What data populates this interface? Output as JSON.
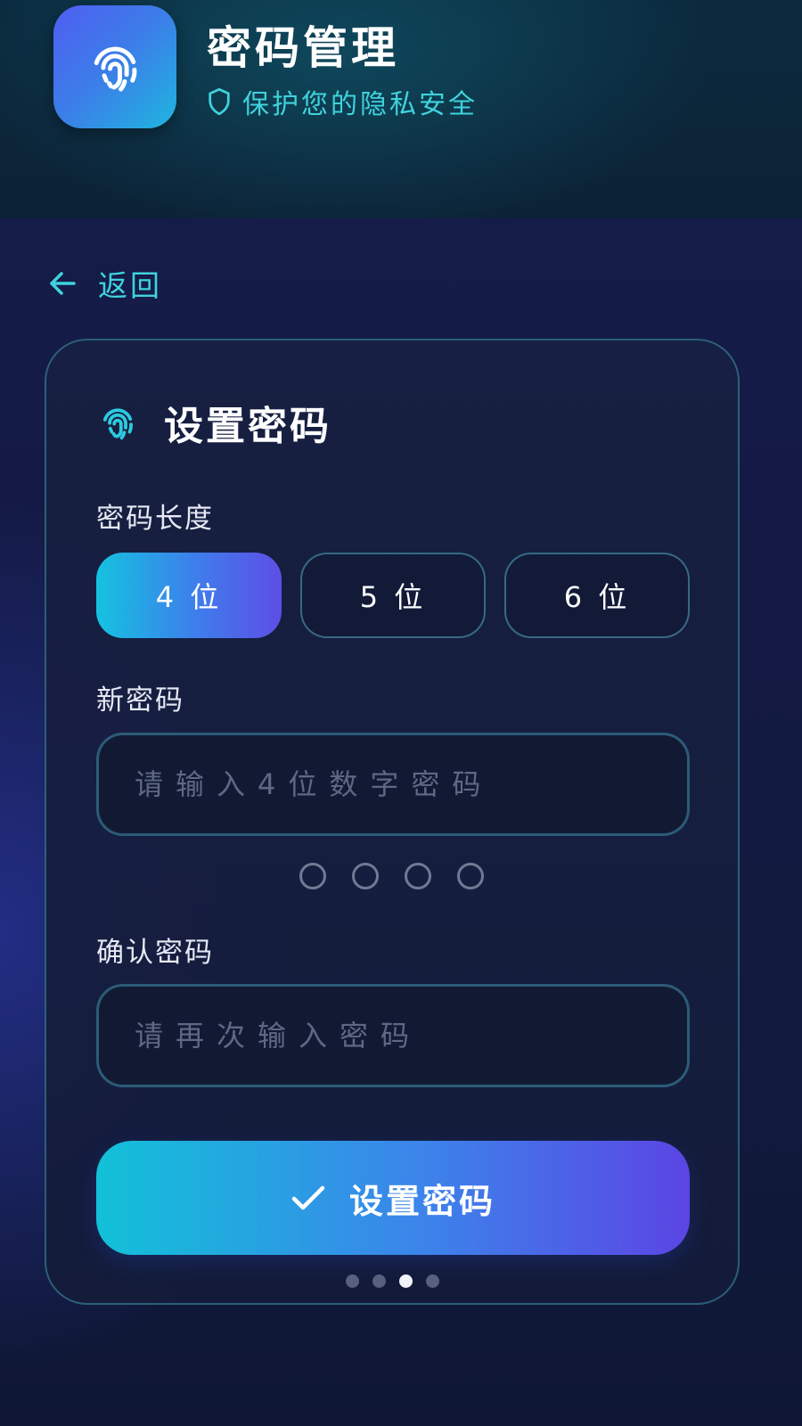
{
  "app": {
    "title": "密码管理",
    "subtitle": "保护您的隐私安全",
    "icon": "fingerprint-icon"
  },
  "nav": {
    "back_label": "返回",
    "back_icon": "arrow-left-icon"
  },
  "card": {
    "title": "设置密码",
    "icon": "fingerprint-icon",
    "length_section": {
      "label": "密码长度",
      "options": [
        {
          "label": "4 位",
          "selected": true
        },
        {
          "label": "5 位",
          "selected": false
        },
        {
          "label": "6 位",
          "selected": false
        }
      ]
    },
    "new_password": {
      "label": "新密码",
      "value": "",
      "placeholder": "请输入4位数字密码",
      "entered_digits": 0,
      "total_digits": 4
    },
    "confirm_password": {
      "label": "确认密码",
      "value": "",
      "placeholder": "请再次输入密码"
    },
    "submit": {
      "label": "设置密码",
      "icon": "check-icon"
    },
    "pagination": {
      "total": 4,
      "current": 3
    }
  },
  "colors": {
    "accent": "#3fd3dd",
    "gradient_start": "#15c2e0",
    "gradient_end": "#5d4ee6",
    "background": "#141a44"
  }
}
